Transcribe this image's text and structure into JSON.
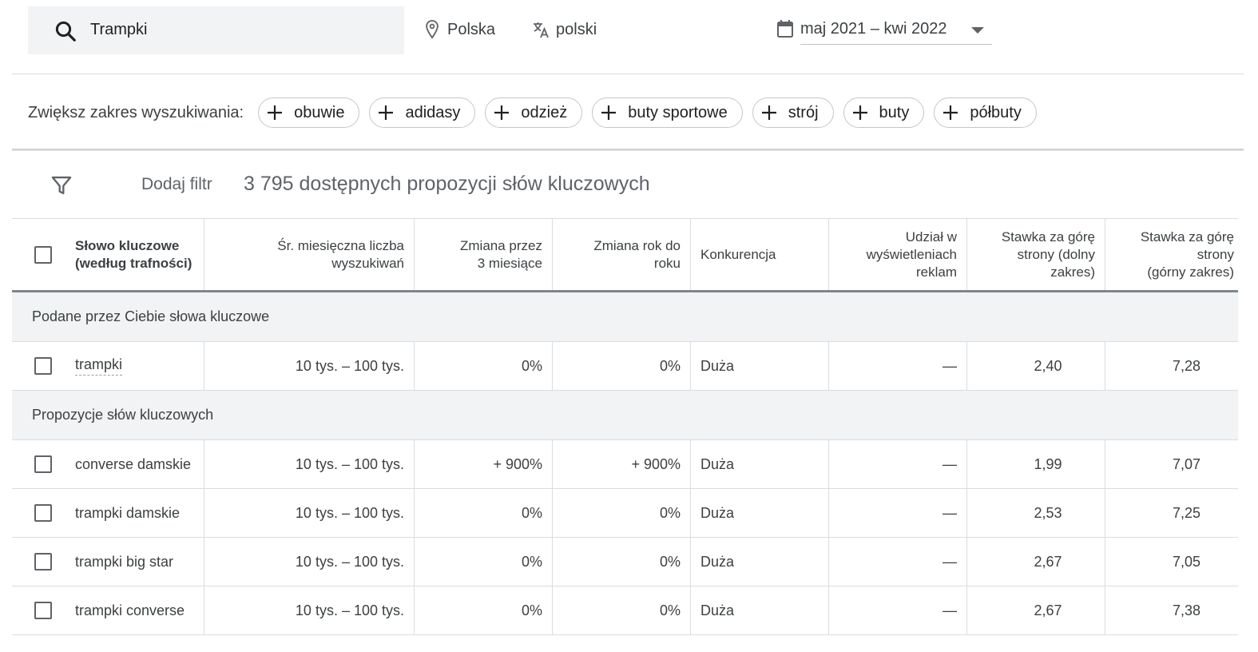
{
  "search": {
    "query": "Trampki"
  },
  "location": {
    "label": "Polska"
  },
  "language": {
    "label": "polski"
  },
  "date_range": {
    "label": "maj 2021 – kwi 2022"
  },
  "broaden": {
    "label": "Zwiększ zakres wyszukiwania:",
    "chips": [
      "obuwie",
      "adidasy",
      "odzież",
      "buty sportowe",
      "strój",
      "buty",
      "półbuty"
    ]
  },
  "filter": {
    "add_label": "Dodaj filtr",
    "count_text": "3 795 dostępnych propozycji słów kluczowych"
  },
  "table": {
    "headers": {
      "keyword_line1": "Słowo kluczowe",
      "keyword_line2": "(według trafności)",
      "avg_line1": "Śr. miesięczna liczba",
      "avg_line2": "wyszukiwań",
      "three_m_line1": "Zmiana przez",
      "three_m_line2": "3 miesiące",
      "yoy_line1": "Zmiana rok do",
      "yoy_line2": "roku",
      "competition": "Konkurencja",
      "ad_line1": "Udział w",
      "ad_line2": "wyświetleniach",
      "ad_line3": "reklam",
      "low_line1": "Stawka za górę",
      "low_line2": "strony (dolny",
      "low_line3": "zakres)",
      "high_line1": "Stawka za górę",
      "high_line2": "strony",
      "high_line3": "(górny zakres)"
    },
    "section_provided": "Podane przez Ciebie słowa kluczowe",
    "provided_rows": [
      {
        "keyword": "trampki",
        "avg": "10 tys. – 100 tys.",
        "three_m": "0%",
        "yoy": "0%",
        "competition": "Duża",
        "ad_share": "—",
        "bid_low": "2,40",
        "bid_high": "7,28"
      }
    ],
    "section_ideas": "Propozycje słów kluczowych",
    "idea_rows": [
      {
        "keyword": "converse damskie",
        "avg": "10 tys. – 100 tys.",
        "three_m": "+ 900%",
        "yoy": "+ 900%",
        "competition": "Duża",
        "ad_share": "—",
        "bid_low": "1,99",
        "bid_high": "7,07"
      },
      {
        "keyword": "trampki damskie",
        "avg": "10 tys. – 100 tys.",
        "three_m": "0%",
        "yoy": "0%",
        "competition": "Duża",
        "ad_share": "—",
        "bid_low": "2,53",
        "bid_high": "7,25"
      },
      {
        "keyword": "trampki big star",
        "avg": "10 tys. – 100 tys.",
        "three_m": "0%",
        "yoy": "0%",
        "competition": "Duża",
        "ad_share": "—",
        "bid_low": "2,67",
        "bid_high": "7,05"
      },
      {
        "keyword": "trampki converse",
        "avg": "10 tys. – 100 tys.",
        "three_m": "0%",
        "yoy": "0%",
        "competition": "Duża",
        "ad_share": "—",
        "bid_low": "2,67",
        "bid_high": "7,38"
      }
    ]
  }
}
